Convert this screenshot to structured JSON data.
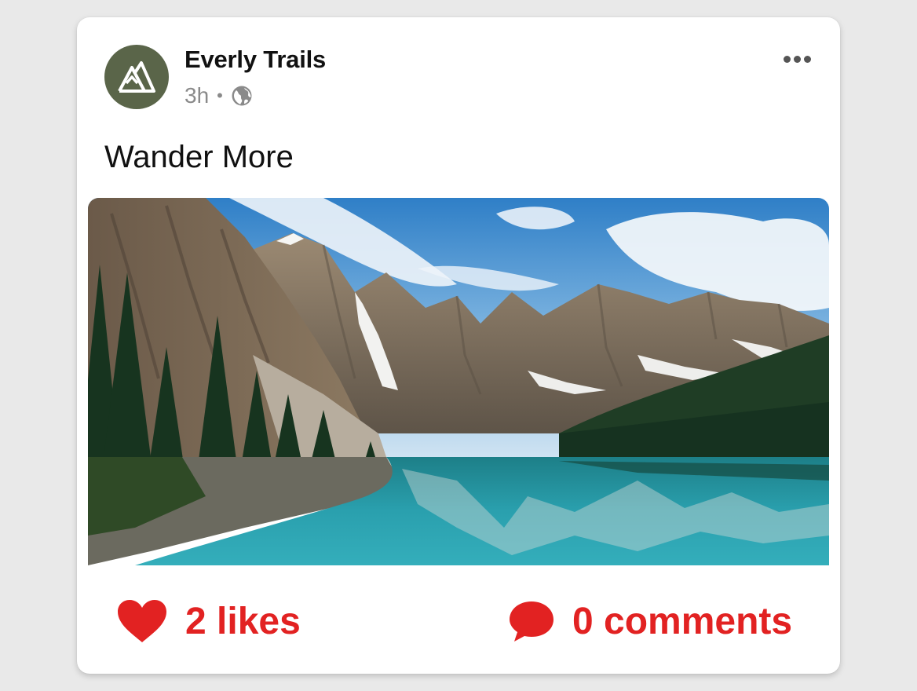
{
  "post": {
    "author": "Everly Trails",
    "time": "3h",
    "separator": "•",
    "caption": "Wander More",
    "avatar_icon": "mountain-logo-icon",
    "visibility_icon": "globe-icon",
    "menu_icon": "more-options-icon",
    "image": "mountain-lake-photo"
  },
  "actions": {
    "likes_label": "2 likes",
    "comments_label": "0 comments"
  },
  "colors": {
    "accent": "#e22222",
    "avatar_bg": "#5a6549",
    "card_bg": "#ffffff",
    "page_bg": "#e9e9e9"
  }
}
